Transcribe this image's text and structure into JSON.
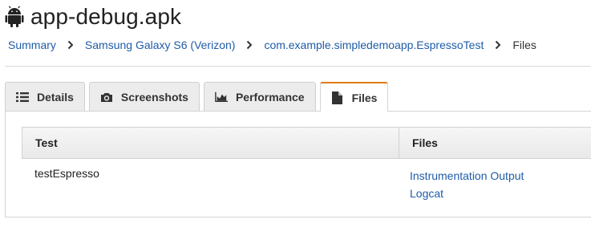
{
  "header": {
    "title": "app-debug.apk",
    "icon": "android-icon"
  },
  "breadcrumb": {
    "items": [
      {
        "label": "Summary"
      },
      {
        "label": "Samsung Galaxy S6 (Verizon)"
      },
      {
        "label": "com.example.simpledemoapp.EspressoTest"
      }
    ],
    "current": "Files",
    "separator_icon": "chevron-right-icon"
  },
  "tabs": [
    {
      "label": "Details",
      "icon": "list-icon"
    },
    {
      "label": "Screenshots",
      "icon": "camera-icon"
    },
    {
      "label": "Performance",
      "icon": "area-chart-icon"
    },
    {
      "label": "Files",
      "icon": "file-icon",
      "active": true
    }
  ],
  "table": {
    "columns": [
      "Test",
      "Files"
    ],
    "rows": [
      {
        "test": "testEspresso",
        "files": [
          "Instrumentation Output",
          "Logcat"
        ]
      }
    ]
  },
  "colors": {
    "link": "#1f5ca8",
    "active_tab_accent": "#e07b12",
    "tab_bg": "#ececec"
  }
}
